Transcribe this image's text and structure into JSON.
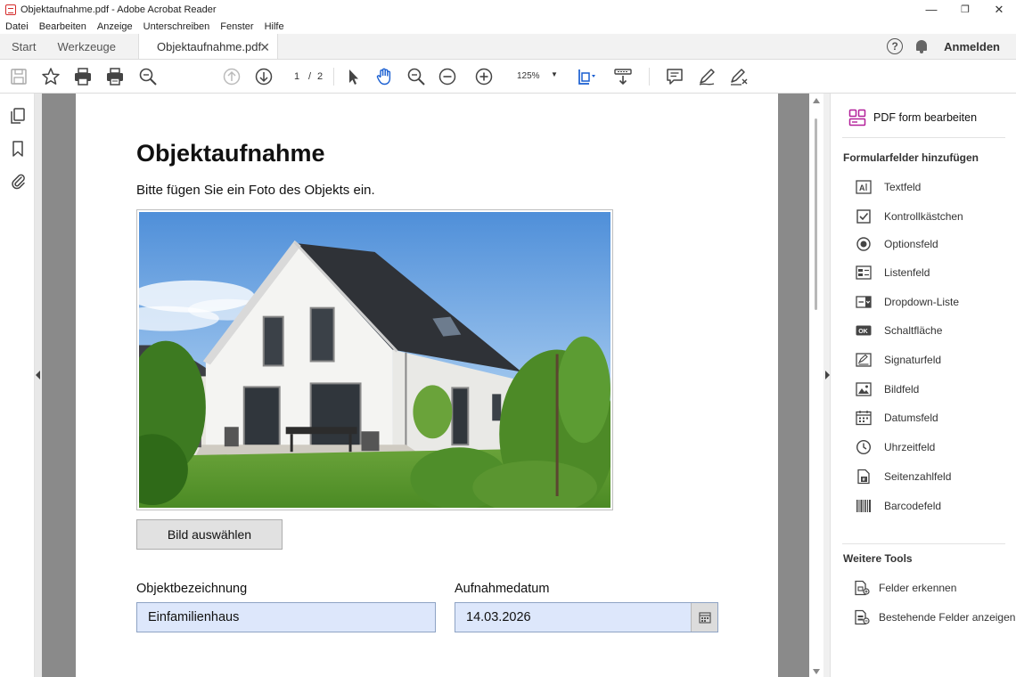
{
  "window": {
    "title": "Objektaufnahme.pdf - Adobe Acrobat Reader",
    "controls": {
      "minimize": "—",
      "restore": "❐",
      "close": "✕"
    }
  },
  "menu": [
    "Datei",
    "Bearbeiten",
    "Anzeige",
    "Unterschreiben",
    "Fenster",
    "Hilfe"
  ],
  "tabs": {
    "home": "Start",
    "tools": "Werkzeuge",
    "document": "Objektaufnahme.pdf",
    "close": "✕",
    "help": "?",
    "login": "Anmelden"
  },
  "toolbar": {
    "current_page": "1",
    "page_separator": "/",
    "total_pages": "2",
    "zoom": "125%"
  },
  "document": {
    "title": "Objektaufnahme",
    "subtitle": "Bitte fügen Sie ein Foto des Objekts ein.",
    "pick_image_button": "Bild auswählen",
    "fields": {
      "name_label": "Objektbezeichnung",
      "name_value": "Einfamilienhaus",
      "date_label": "Aufnahmedatum",
      "date_value": "14.03.2026"
    }
  },
  "panel": {
    "header": "PDF form bearbeiten",
    "section_add": "Formularfelder hinzufügen",
    "items": [
      {
        "label": "Textfeld",
        "icon": "text-field-icon"
      },
      {
        "label": "Kontrollkästchen",
        "icon": "checkbox-icon"
      },
      {
        "label": "Optionsfeld",
        "icon": "radio-icon"
      },
      {
        "label": "Listenfeld",
        "icon": "list-box-icon"
      },
      {
        "label": "Dropdown-Liste",
        "icon": "dropdown-icon"
      },
      {
        "label": "Schaltfläche",
        "icon": "button-icon"
      },
      {
        "label": "Signaturfeld",
        "icon": "signature-icon"
      },
      {
        "label": "Bildfeld",
        "icon": "image-field-icon"
      },
      {
        "label": "Datumsfeld",
        "icon": "date-field-icon"
      },
      {
        "label": "Uhrzeitfeld",
        "icon": "clock-icon"
      },
      {
        "label": "Seitenzahlfeld",
        "icon": "page-number-icon"
      },
      {
        "label": "Barcodefeld",
        "icon": "barcode-icon"
      }
    ],
    "button_icon_text": "OK",
    "section_more": "Weitere Tools",
    "tools": [
      {
        "label": "Felder erkennen",
        "icon": "detect-fields-icon"
      },
      {
        "label": "Bestehende Felder anzeigen",
        "icon": "show-fields-icon"
      }
    ]
  },
  "colors": {
    "field_bg": "#dde7fb",
    "panel_accent": "#b3209a",
    "canvas_gray": "#8a8a8a"
  }
}
